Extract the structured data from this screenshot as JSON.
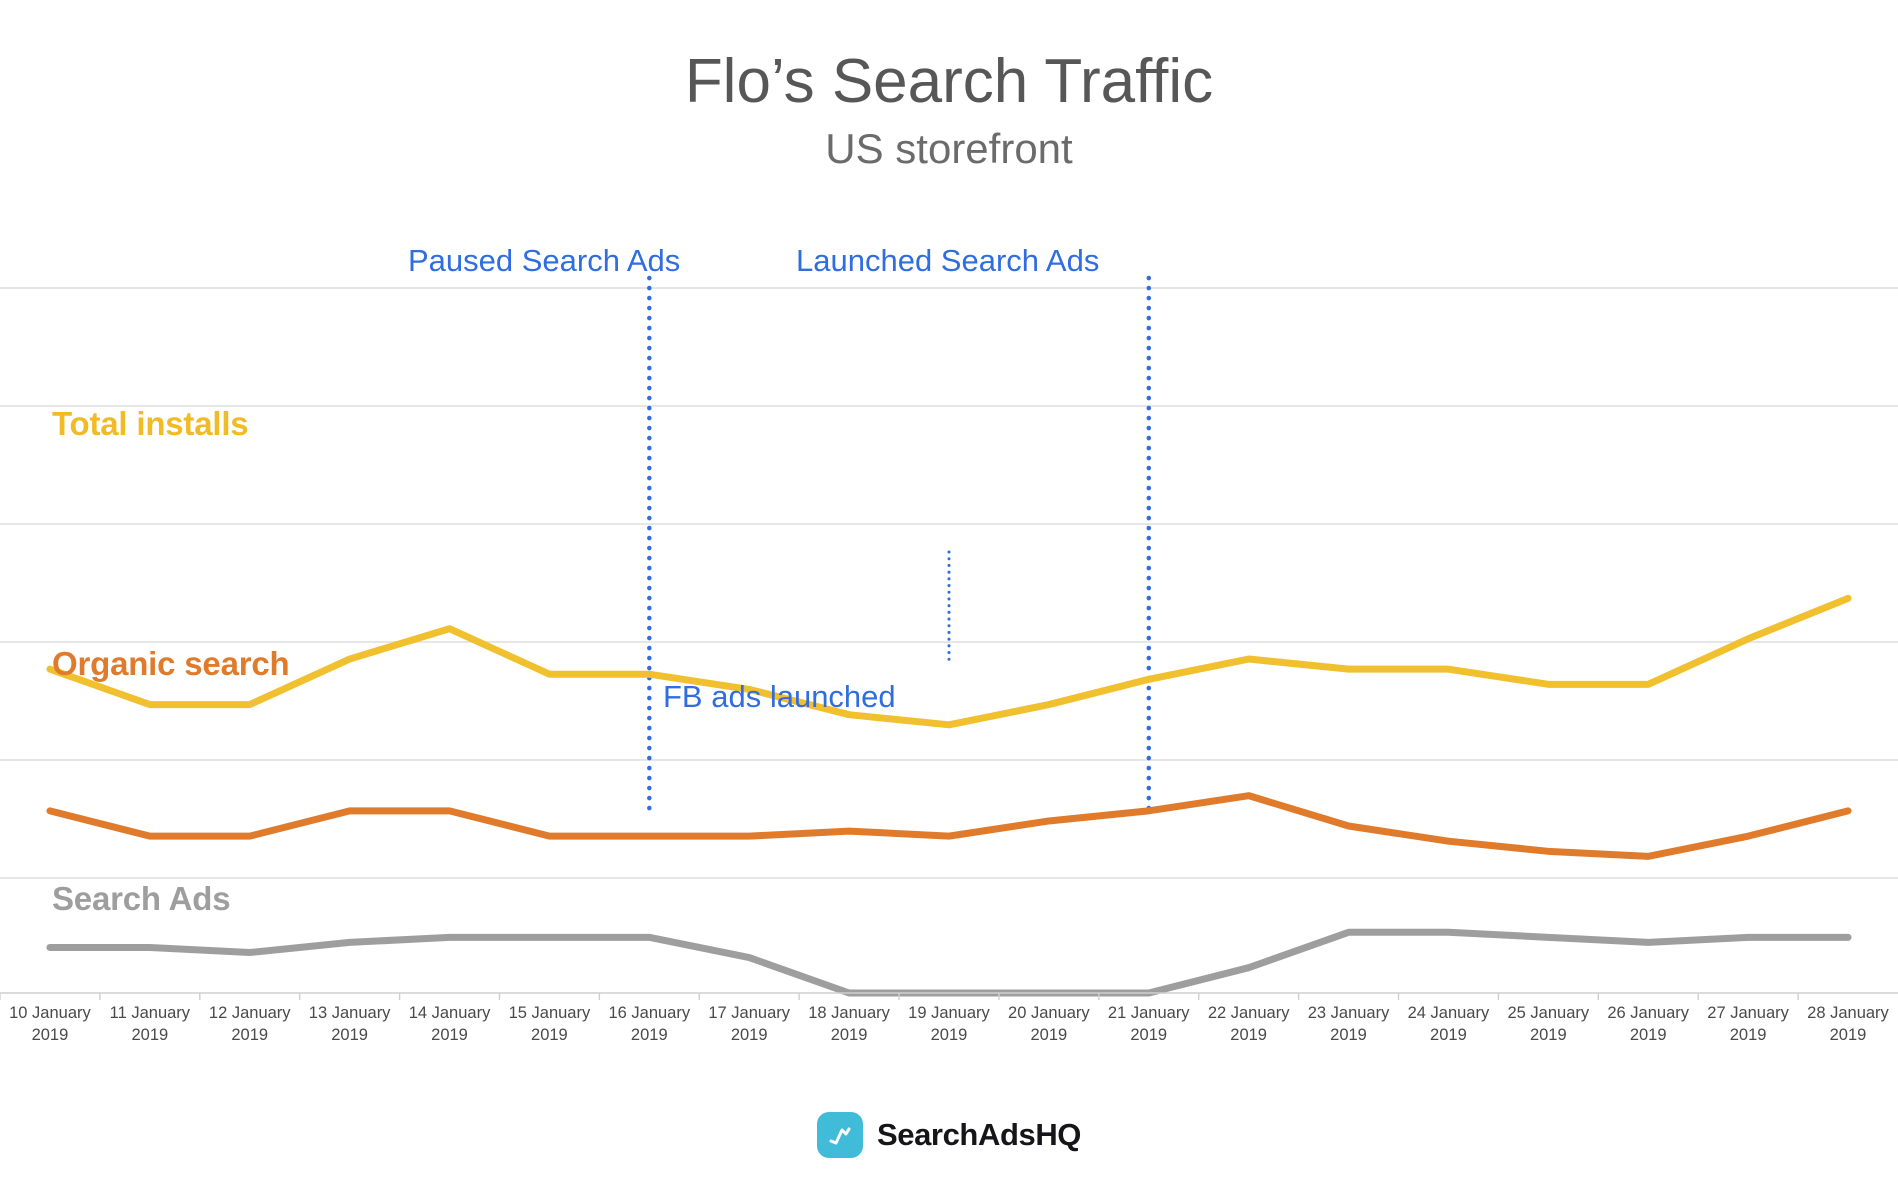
{
  "header": {
    "title": "Flo’s Search Traffic",
    "subtitle": "US storefront"
  },
  "annotations": {
    "paused": "Paused Search Ads",
    "launched": "Launched Search Ads",
    "fb_ads": "FB ads launched"
  },
  "series_labels": {
    "total_installs": "Total installs",
    "organic_search": "Organic search",
    "search_ads": "Search Ads"
  },
  "footer": {
    "logo_icon": "line-chart-icon",
    "brand": "SearchAdsHQ"
  },
  "colors": {
    "total_installs": "#f1c02e",
    "organic_search": "#e07b2c",
    "search_ads": "#9e9e9e",
    "annotation": "#2f6de0",
    "gridline": "#dedede",
    "title": "#575757",
    "logo_tile": "#41bcd8"
  },
  "chart_data": {
    "type": "line",
    "title": "Flo’s Search Traffic",
    "subtitle": "US storefront",
    "xlabel": "",
    "ylabel": "",
    "grid": true,
    "legend_position": "inline-left",
    "x": [
      "10 January 2019",
      "11 January 2019",
      "12 January 2019",
      "13 January 2019",
      "14 January 2019",
      "15 January 2019",
      "16 January 2019",
      "17 January 2019",
      "18 January 2019",
      "19 January 2019",
      "20 January 2019",
      "21 January 2019",
      "22 January 2019",
      "23 January 2019",
      "24 January 2019",
      "25 January 2019",
      "26 January 2019",
      "27 January 2019",
      "28 January 2019"
    ],
    "x_tick_lines": [
      [
        "10 January",
        "2019"
      ],
      [
        "11 January",
        "2019"
      ],
      [
        "12 January",
        "2019"
      ],
      [
        "13 January",
        "2019"
      ],
      [
        "14 January",
        "2019"
      ],
      [
        "15 January",
        "2019"
      ],
      [
        "16 January",
        "2019"
      ],
      [
        "17 January",
        "2019"
      ],
      [
        "18 January",
        "2019"
      ],
      [
        "19 January",
        "2019"
      ],
      [
        "20 January",
        "2019"
      ],
      [
        "21 January",
        "2019"
      ],
      [
        "22 January",
        "2019"
      ],
      [
        "23 January",
        "2019"
      ],
      [
        "24 January",
        "2019"
      ],
      [
        "25 January",
        "2019"
      ],
      [
        "26 January",
        "2019"
      ],
      [
        "27 January",
        "2019"
      ],
      [
        "28 January",
        "2019"
      ]
    ],
    "ylim": [
      0,
      100
    ],
    "series": [
      {
        "name": "Total installs",
        "color": "#f1c02e",
        "values": [
          64,
          57,
          57,
          66,
          72,
          63,
          63,
          60,
          55,
          53,
          57,
          62,
          66,
          64,
          64,
          61,
          61,
          70,
          78
        ]
      },
      {
        "name": "Organic search",
        "color": "#e07b2c",
        "values": [
          36,
          31,
          31,
          36,
          36,
          31,
          31,
          31,
          32,
          31,
          34,
          36,
          39,
          33,
          30,
          28,
          27,
          31,
          36
        ]
      },
      {
        "name": "Search Ads",
        "color": "#9e9e9e",
        "values": [
          9,
          9,
          8,
          10,
          11,
          11,
          11,
          7,
          0,
          0,
          0,
          0,
          5,
          12,
          12,
          11,
          10,
          11,
          11
        ]
      }
    ],
    "event_markers": [
      {
        "label": "Paused Search Ads",
        "x": "16 January 2019"
      },
      {
        "label": "Launched Search Ads",
        "x": "21 January 2019"
      },
      {
        "label": "FB ads launched",
        "x": "19 January 2019"
      }
    ]
  }
}
